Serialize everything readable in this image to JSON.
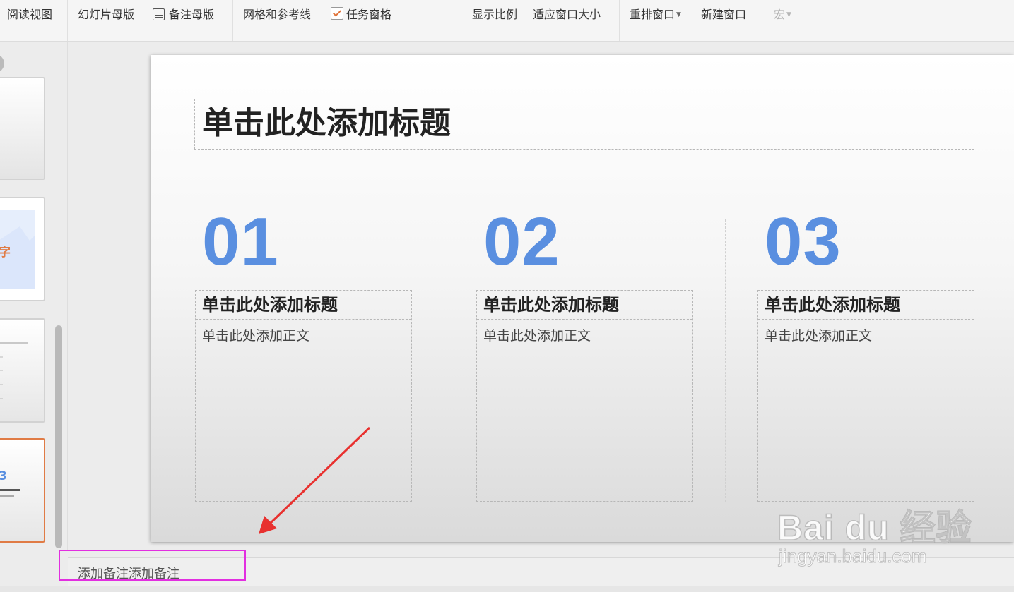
{
  "toolbar": {
    "reading_view": "阅读视图",
    "slide_master": "幻灯片母版",
    "notes_master": "备注母版",
    "grid_guides": "网格和参考线",
    "task_pane": "任务窗格",
    "zoom": "显示比例",
    "fit_window": "适应窗口大小",
    "arrange_windows": "重排窗口",
    "new_window": "新建窗口",
    "macro": "宏"
  },
  "thumbnails": {
    "thumb2_text": "字",
    "thumb4_number": "3"
  },
  "slide": {
    "title": "单击此处添加标题",
    "columns": [
      {
        "number": "01",
        "title": "单击此处添加标题",
        "body": "单击此处添加正文"
      },
      {
        "number": "02",
        "title": "单击此处添加标题",
        "body": "单击此处添加正文"
      },
      {
        "number": "03",
        "title": "单击此处添加标题",
        "body": "单击此处添加正文"
      }
    ]
  },
  "notes": {
    "text": "添加备注添加备注"
  },
  "watermark": {
    "logo": "Bai du 经验",
    "url": "jingyan.baidu.com"
  },
  "colors": {
    "accent_number": "#5a8fe0",
    "highlight_box": "#e22fe0",
    "arrow": "#e8312f",
    "active_thumb": "#e07b45"
  }
}
